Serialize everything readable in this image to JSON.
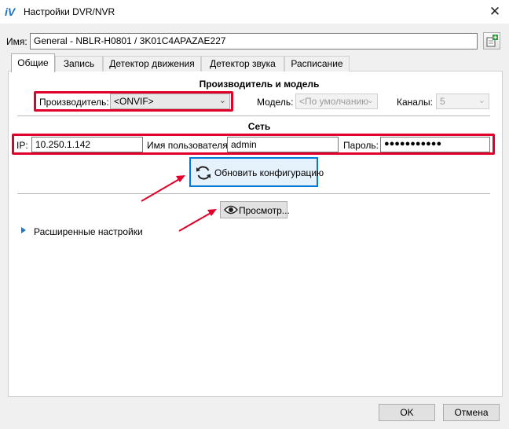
{
  "window": {
    "title": "Настройки DVR/NVR",
    "logo_text": "iV",
    "close_glyph": "✕"
  },
  "name_row": {
    "label": "Имя:",
    "value": "General - NBLR-H0801 / 3K01C4APAZAE227"
  },
  "tabs": [
    {
      "label": "Общие",
      "active": true
    },
    {
      "label": "Запись",
      "active": false
    },
    {
      "label": "Детектор движения",
      "active": false
    },
    {
      "label": "Детектор звука",
      "active": false
    },
    {
      "label": "Расписание",
      "active": false
    }
  ],
  "manufacturer_section": {
    "title": "Производитель и модель",
    "manufacturer_label": "Производитель:",
    "manufacturer_value": "<ONVIF>",
    "model_label": "Модель:",
    "model_value": "<По умолчанию",
    "channels_label": "Каналы:",
    "channels_value": "5"
  },
  "network_section": {
    "title": "Сеть",
    "ip_label": "IP:",
    "ip_value": "10.250.1.142",
    "user_label": "Имя пользователя:",
    "user_value": "admin",
    "password_label": "Пароль:",
    "password_value": "●●●●●●●●●●●"
  },
  "buttons": {
    "refresh_config": "Обновить конфигурацию",
    "preview": "Просмотр...",
    "ok": "OK",
    "cancel": "Отмена"
  },
  "advanced": {
    "label": "Расширенные настройки"
  },
  "colors": {
    "highlight_red": "#e0002a",
    "accent_blue": "#0078d7",
    "logo_blue": "#1a6fc0"
  },
  "icons": {
    "refresh": "refresh-icon",
    "preview": "eye-icon",
    "expand": "triangle-right-icon"
  }
}
